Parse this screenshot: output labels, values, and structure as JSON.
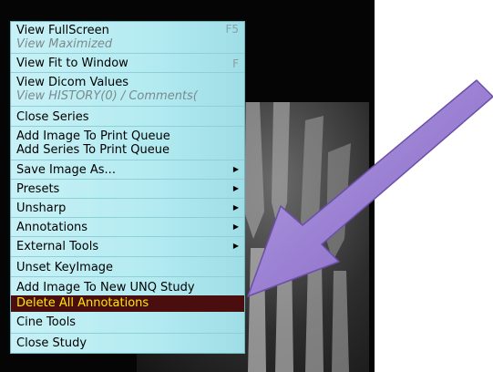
{
  "menu": {
    "items": [
      {
        "name": "view-fullscreen",
        "label": "View FullScreen",
        "shortcut": "F5",
        "sub": "View Maximized"
      },
      {
        "name": "view-fit-to-window",
        "label": "View Fit to Window",
        "shortcut": "F"
      },
      {
        "name": "view-dicom-values",
        "label": "View Dicom Values",
        "sub": "View HISTORY(0) / Comments("
      },
      {
        "name": "close-series",
        "label": "Close Series"
      },
      {
        "name": "add-image-to-print-queue",
        "label": "Add Image To Print Queue",
        "label2": "Add Series To Print Queue"
      },
      {
        "name": "save-image-as",
        "label": "Save Image As...",
        "submenu": true
      },
      {
        "name": "presets",
        "label": "Presets",
        "submenu": true
      },
      {
        "name": "unsharp",
        "label": "Unsharp",
        "submenu": true
      },
      {
        "name": "annotations",
        "label": "Annotations",
        "submenu": true
      },
      {
        "name": "external-tools",
        "label": "External Tools",
        "submenu": true
      },
      {
        "name": "unset-keyimage",
        "label": "Unset KeyImage"
      },
      {
        "name": "add-image-to-new-unq-study",
        "label": "Add Image To New UNQ Study"
      },
      {
        "name": "delete-all-annotations",
        "label": "Delete All Annotations",
        "selected": true
      },
      {
        "name": "cine-tools",
        "label": "Cine Tools"
      },
      {
        "name": "close-study",
        "label": "Close Study"
      }
    ]
  },
  "colors": {
    "menu_bg": "#b3ebf1",
    "selected_bg": "#4a0e0e",
    "selected_text": "#ffe600",
    "arrow": "#9b7fd0"
  },
  "icons": {
    "submenu": "submenu-arrow-icon",
    "pointer": "pointer-arrow-icon"
  }
}
